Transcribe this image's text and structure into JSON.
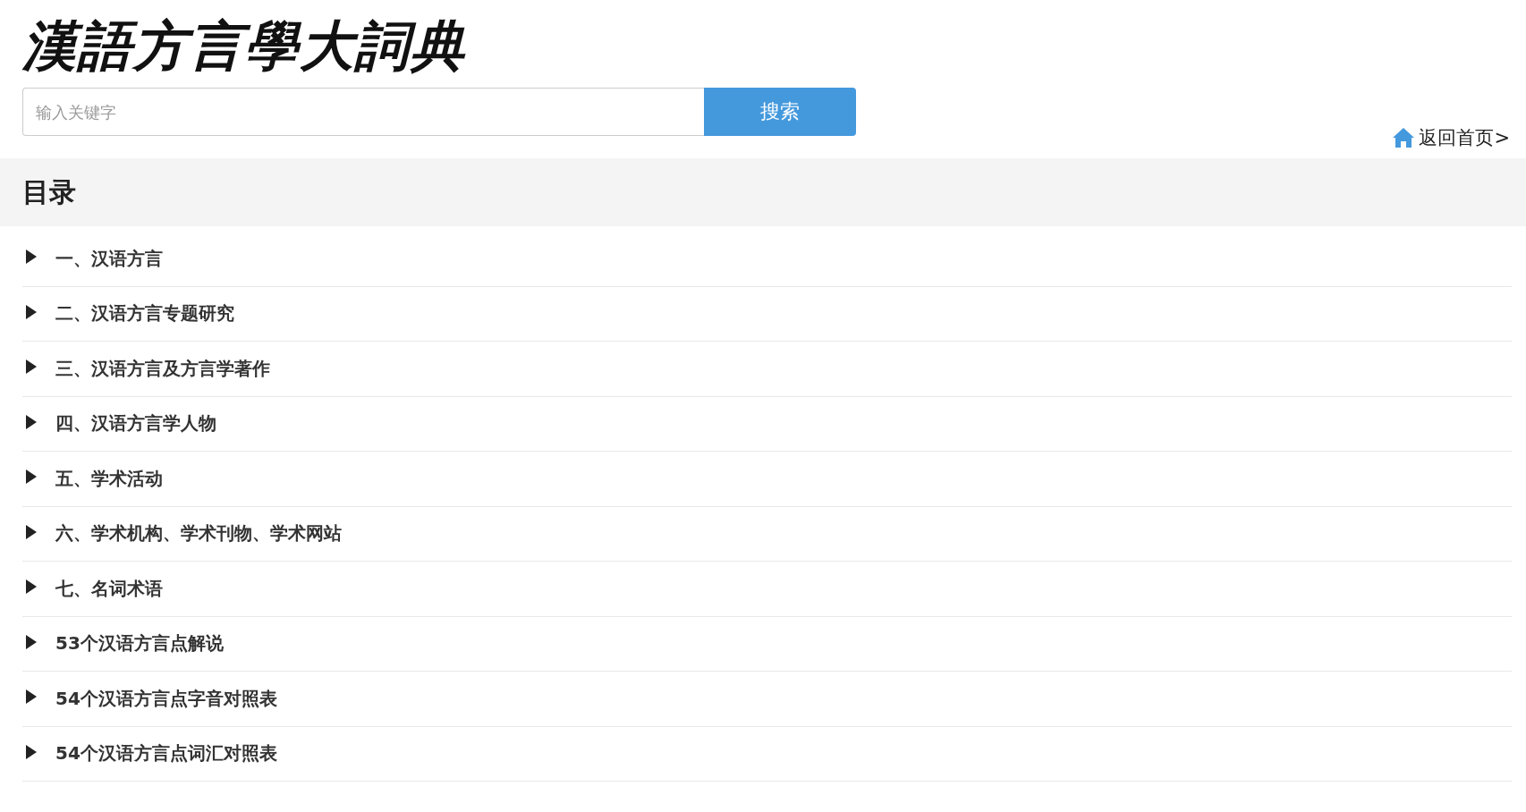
{
  "logo": {
    "text": "漢語方言學大詞典"
  },
  "search": {
    "placeholder": "输入关键字",
    "button": "搜索"
  },
  "home_link": {
    "label": "返回首页>"
  },
  "catalog": {
    "title": "目录",
    "items": [
      {
        "label": "一、汉语方言",
        "expanded": false
      },
      {
        "label": "二、汉语方言专题研究",
        "expanded": false
      },
      {
        "label": "三、汉语方言及方言学著作",
        "expanded": false
      },
      {
        "label": "四、汉语方言学人物",
        "expanded": false
      },
      {
        "label": "五、学术活动",
        "expanded": false
      },
      {
        "label": "六、学术机构、学术刊物、学术网站",
        "expanded": false
      },
      {
        "label": "七、名词术语",
        "expanded": false
      },
      {
        "label": "53个汉语方言点解说",
        "expanded": false
      },
      {
        "label": "54个汉语方言点字音对照表",
        "expanded": false
      },
      {
        "label": "54个汉语方言点词汇对照表",
        "expanded": false
      }
    ]
  }
}
